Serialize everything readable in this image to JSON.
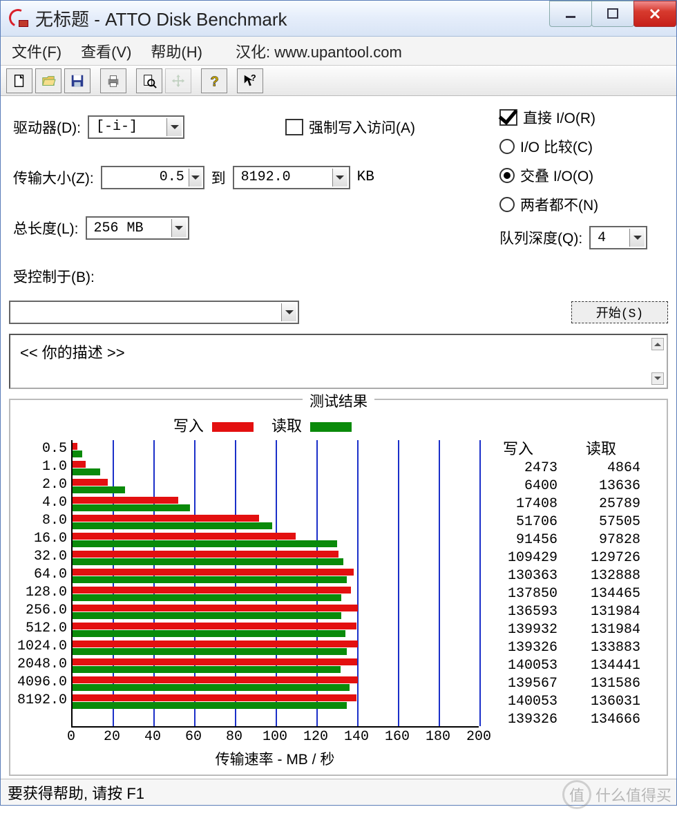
{
  "window": {
    "title": "无标题 - ATTO Disk Benchmark"
  },
  "menu": {
    "file": "文件(F)",
    "view": "查看(V)",
    "help": "帮助(H)",
    "credit": "汉化: www.upantool.com"
  },
  "labels": {
    "drive": "驱动器(D):",
    "transfer": "传输大小(Z):",
    "to": "到",
    "unit": "KB",
    "total": "总长度(L):",
    "force": "强制写入访问(A)",
    "direct": "直接 I/O(R)",
    "compare": "I/O 比较(C)",
    "overlap": "交叠 I/O(O)",
    "neither": "两者都不(N)",
    "queue": "队列深度(Q):",
    "controlled": "受控制于(B):",
    "start": "开始(S)",
    "desc": "<<  你的描述   >>",
    "results": "测试结果",
    "write": "写入",
    "read": "读取",
    "xlabel": "传输速率 - MB / 秒",
    "status": "要获得帮助, 请按 F1",
    "watermark": "什么值得买"
  },
  "values": {
    "drive": "[-i-]",
    "tr_from": "0.5",
    "tr_to": "8192.0",
    "total": "256 MB",
    "queue": "4",
    "force_on": false,
    "direct_on": true,
    "radio_selected": "overlap"
  },
  "chart_data": {
    "type": "bar",
    "xlabel": "传输速率 - MB / 秒",
    "xlim": [
      0,
      200
    ],
    "xticks": [
      0,
      20,
      40,
      60,
      80,
      100,
      120,
      140,
      160,
      180,
      200
    ],
    "categories": [
      "0.5",
      "1.0",
      "2.0",
      "4.0",
      "8.0",
      "16.0",
      "32.0",
      "64.0",
      "128.0",
      "256.0",
      "512.0",
      "1024.0",
      "2048.0",
      "4096.0",
      "8192.0"
    ],
    "series": [
      {
        "name": "写入",
        "color": "#e31010",
        "values": [
          2473,
          6400,
          17408,
          51706,
          91456,
          109429,
          130363,
          137850,
          136593,
          139932,
          139326,
          140053,
          139567,
          140053,
          139326
        ]
      },
      {
        "name": "读取",
        "color": "#0a8a0a",
        "values": [
          4864,
          13636,
          25789,
          57505,
          97828,
          129726,
          132888,
          134465,
          131984,
          131984,
          133883,
          134441,
          131586,
          136031,
          134666
        ]
      }
    ]
  }
}
